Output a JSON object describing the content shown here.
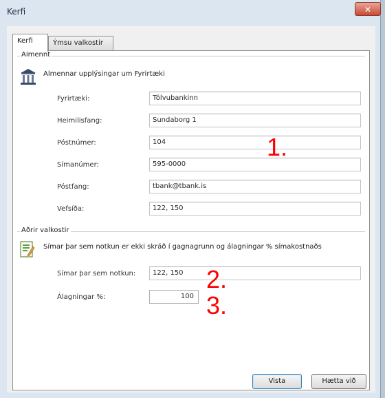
{
  "window": {
    "title": "Kerfi",
    "close_glyph": "✕"
  },
  "tabs": [
    {
      "label": "Kerfi",
      "active": true
    },
    {
      "label": "Ýmsu valkostir",
      "active": false
    }
  ],
  "groups": {
    "general": {
      "title": "Almennt",
      "description": "Almennar upplýsingar um Fyrirtæki",
      "icon": "bank-building-icon",
      "fields": [
        {
          "label": "Fyrirtæki:",
          "value": "Tölvubankinn"
        },
        {
          "label": "Heimilisfang:",
          "value": "Sundaborg 1"
        },
        {
          "label": "Póstnúmer:",
          "value": "104"
        },
        {
          "label": "Símanúmer:",
          "value": "595-0000"
        },
        {
          "label": "Póstfang:",
          "value": "tbank@tbank.is"
        },
        {
          "label": "Vefsíða:",
          "value": "122, 150"
        }
      ]
    },
    "other": {
      "title": "Aðrir valkostir",
      "description": "Símar þar sem notkun er ekki skráð í gagnagrunn og álagningar % símakostnaðs",
      "icon": "edit-document-icon",
      "fields": [
        {
          "label": "Símar þar sem notkun:",
          "value": "122, 150"
        },
        {
          "label": "Álagningar %:",
          "value": "100"
        }
      ]
    }
  },
  "annotations": [
    "1.",
    "2.",
    "3."
  ],
  "buttons": {
    "save": "Vista",
    "cancel": "Hætta við"
  },
  "colors": {
    "annotation": "#ff0000",
    "close_button": "#c94a33",
    "window_frame": "#dbe6f1"
  }
}
